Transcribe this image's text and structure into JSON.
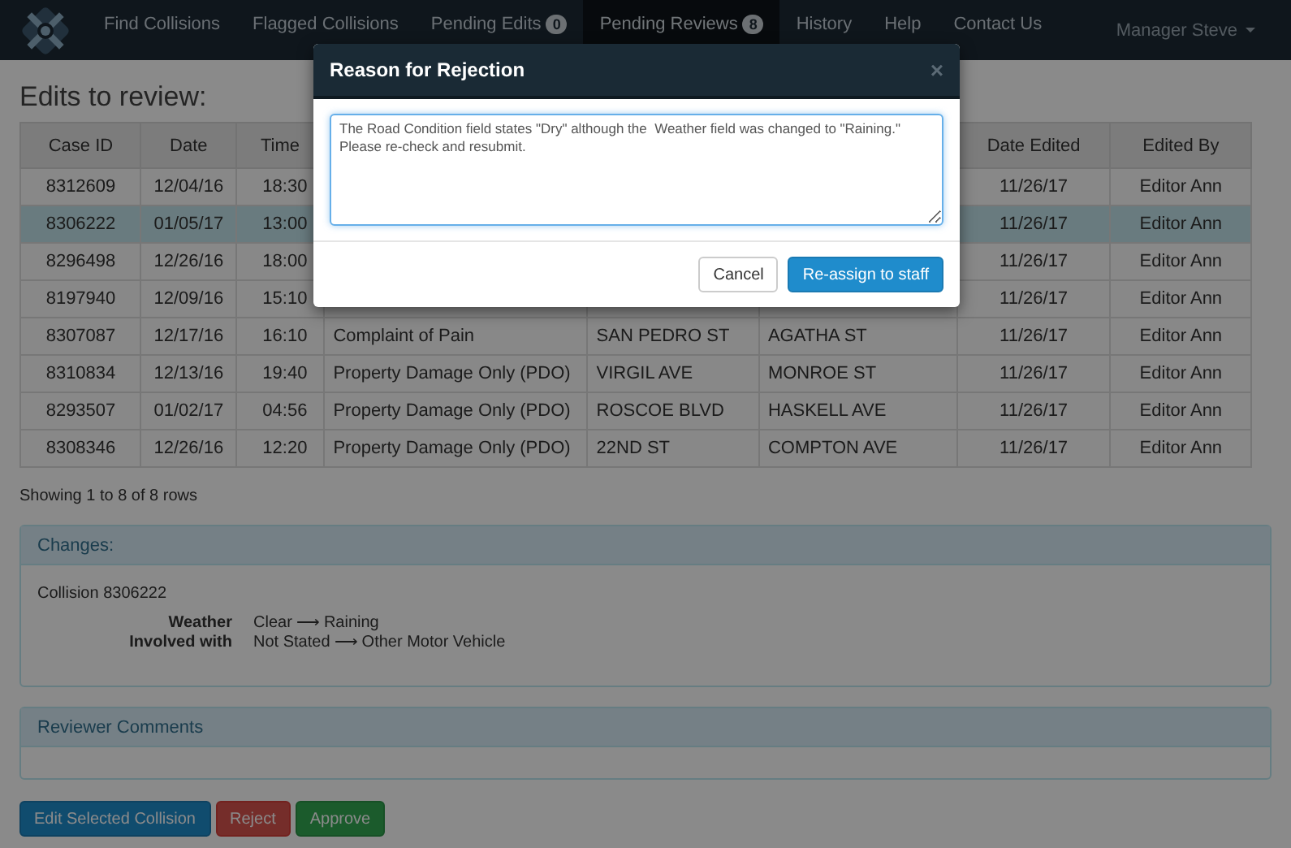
{
  "navbar": {
    "user": "Manager Steve",
    "items": [
      {
        "label": "Find Collisions",
        "selected": false
      },
      {
        "label": "Flagged Collisions",
        "selected": false
      },
      {
        "label": "Pending Edits",
        "badge": "0",
        "selected": false
      },
      {
        "label": "Pending Reviews",
        "badge": "8",
        "selected": true
      },
      {
        "label": "History",
        "selected": false
      },
      {
        "label": "Help",
        "selected": false
      },
      {
        "label": "Contact Us",
        "selected": false
      }
    ]
  },
  "heading": "Edits to review:",
  "table": {
    "columns": [
      "Case ID",
      "Date",
      "Time",
      null,
      null,
      null,
      "Date Edited",
      "Edited By"
    ],
    "rows": [
      {
        "cells": [
          "8312609",
          "12/04/16",
          "18:30",
          null,
          null,
          null,
          "11/26/17",
          "Editor Ann"
        ],
        "selected": false
      },
      {
        "cells": [
          "8306222",
          "01/05/17",
          "13:00",
          null,
          null,
          null,
          "11/26/17",
          "Editor Ann"
        ],
        "selected": true
      },
      {
        "cells": [
          "8296498",
          "12/26/16",
          "18:00",
          null,
          null,
          null,
          "11/26/17",
          "Editor Ann"
        ],
        "selected": false
      },
      {
        "cells": [
          "8197940",
          "12/09/16",
          "15:10",
          null,
          null,
          null,
          "11/26/17",
          "Editor Ann"
        ],
        "selected": false
      },
      {
        "cells": [
          "8307087",
          "12/17/16",
          "16:10",
          "Complaint of Pain",
          "SAN PEDRO ST",
          "AGATHA ST",
          "11/26/17",
          "Editor Ann"
        ],
        "selected": false
      },
      {
        "cells": [
          "8310834",
          "12/13/16",
          "19:40",
          "Property Damage Only (PDO)",
          "VIRGIL AVE",
          "MONROE ST",
          "11/26/17",
          "Editor Ann"
        ],
        "selected": false
      },
      {
        "cells": [
          "8293507",
          "01/02/17",
          "04:56",
          "Property Damage Only (PDO)",
          "ROSCOE BLVD",
          "HASKELL AVE",
          "11/26/17",
          "Editor Ann"
        ],
        "selected": false
      },
      {
        "cells": [
          "8308346",
          "12/26/16",
          "12:20",
          "Property Damage Only (PDO)",
          "22ND ST",
          "COMPTON AVE",
          "11/26/17",
          "Editor Ann"
        ],
        "selected": false
      }
    ],
    "footer": "Showing 1 to 8 of 8 rows"
  },
  "changes": {
    "title": "Changes:",
    "collision": "Collision 8306222",
    "fields": [
      {
        "label": "Weather",
        "value": "Clear ⟶ Raining"
      },
      {
        "label": "Involved with",
        "value": "Not Stated ⟶ Other Motor Vehicle"
      }
    ]
  },
  "reviewer_comments": {
    "title": "Reviewer Comments"
  },
  "buttons": [
    {
      "label": "Edit Selected Collision",
      "kind": "primary"
    },
    {
      "label": "Reject",
      "kind": "danger"
    },
    {
      "label": "Approve",
      "kind": "success"
    }
  ],
  "modal": {
    "title": "Reason for Rejection",
    "close": "×",
    "text": "The Road Condition field states \"Dry\" although the  Weather field was changed to \"Raining.\"\nPlease re-check and resubmit.",
    "buttons": [
      {
        "label": "Cancel",
        "kind": "default"
      },
      {
        "label": "Re-assign to staff",
        "kind": "primary"
      }
    ]
  }
}
